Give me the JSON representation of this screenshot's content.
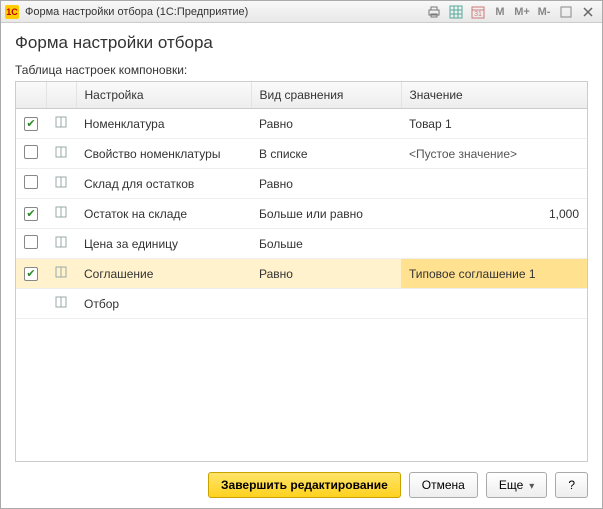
{
  "titlebar": {
    "app_icon_text": "1C",
    "title": "Форма настройки отбора  (1С:Предприятие)",
    "m_labels": [
      "M",
      "M+",
      "M-"
    ]
  },
  "page": {
    "title": "Форма настройки отбора",
    "table_caption": "Таблица настроек компоновки:"
  },
  "columns": {
    "setting": "Настройка",
    "comparison": "Вид сравнения",
    "value": "Значение"
  },
  "rows": [
    {
      "checked": true,
      "label": "Номенклатура",
      "cmp": "Равно",
      "val": "Товар 1",
      "numeric": false,
      "selected": false
    },
    {
      "checked": false,
      "label": "Свойство номенклатуры",
      "cmp": "В списке",
      "val": "<Пустое значение>",
      "numeric": false,
      "selected": false
    },
    {
      "checked": false,
      "label": "Склад для остатков",
      "cmp": "Равно",
      "val": "",
      "numeric": false,
      "selected": false
    },
    {
      "checked": true,
      "label": "Остаток на складе",
      "cmp": "Больше или равно",
      "val": "1,000",
      "numeric": true,
      "selected": false
    },
    {
      "checked": false,
      "label": "Цена за единицу",
      "cmp": "Больше",
      "val": "",
      "numeric": false,
      "selected": false
    },
    {
      "checked": true,
      "label": "Соглашение",
      "cmp": "Равно",
      "val": "Типовое соглашение 1",
      "numeric": false,
      "selected": true
    },
    {
      "checked": null,
      "label": "Отбор",
      "cmp": "",
      "val": "",
      "numeric": false,
      "selected": false
    }
  ],
  "footer": {
    "finish": "Завершить редактирование",
    "cancel": "Отмена",
    "more": "Еще",
    "help": "?"
  }
}
